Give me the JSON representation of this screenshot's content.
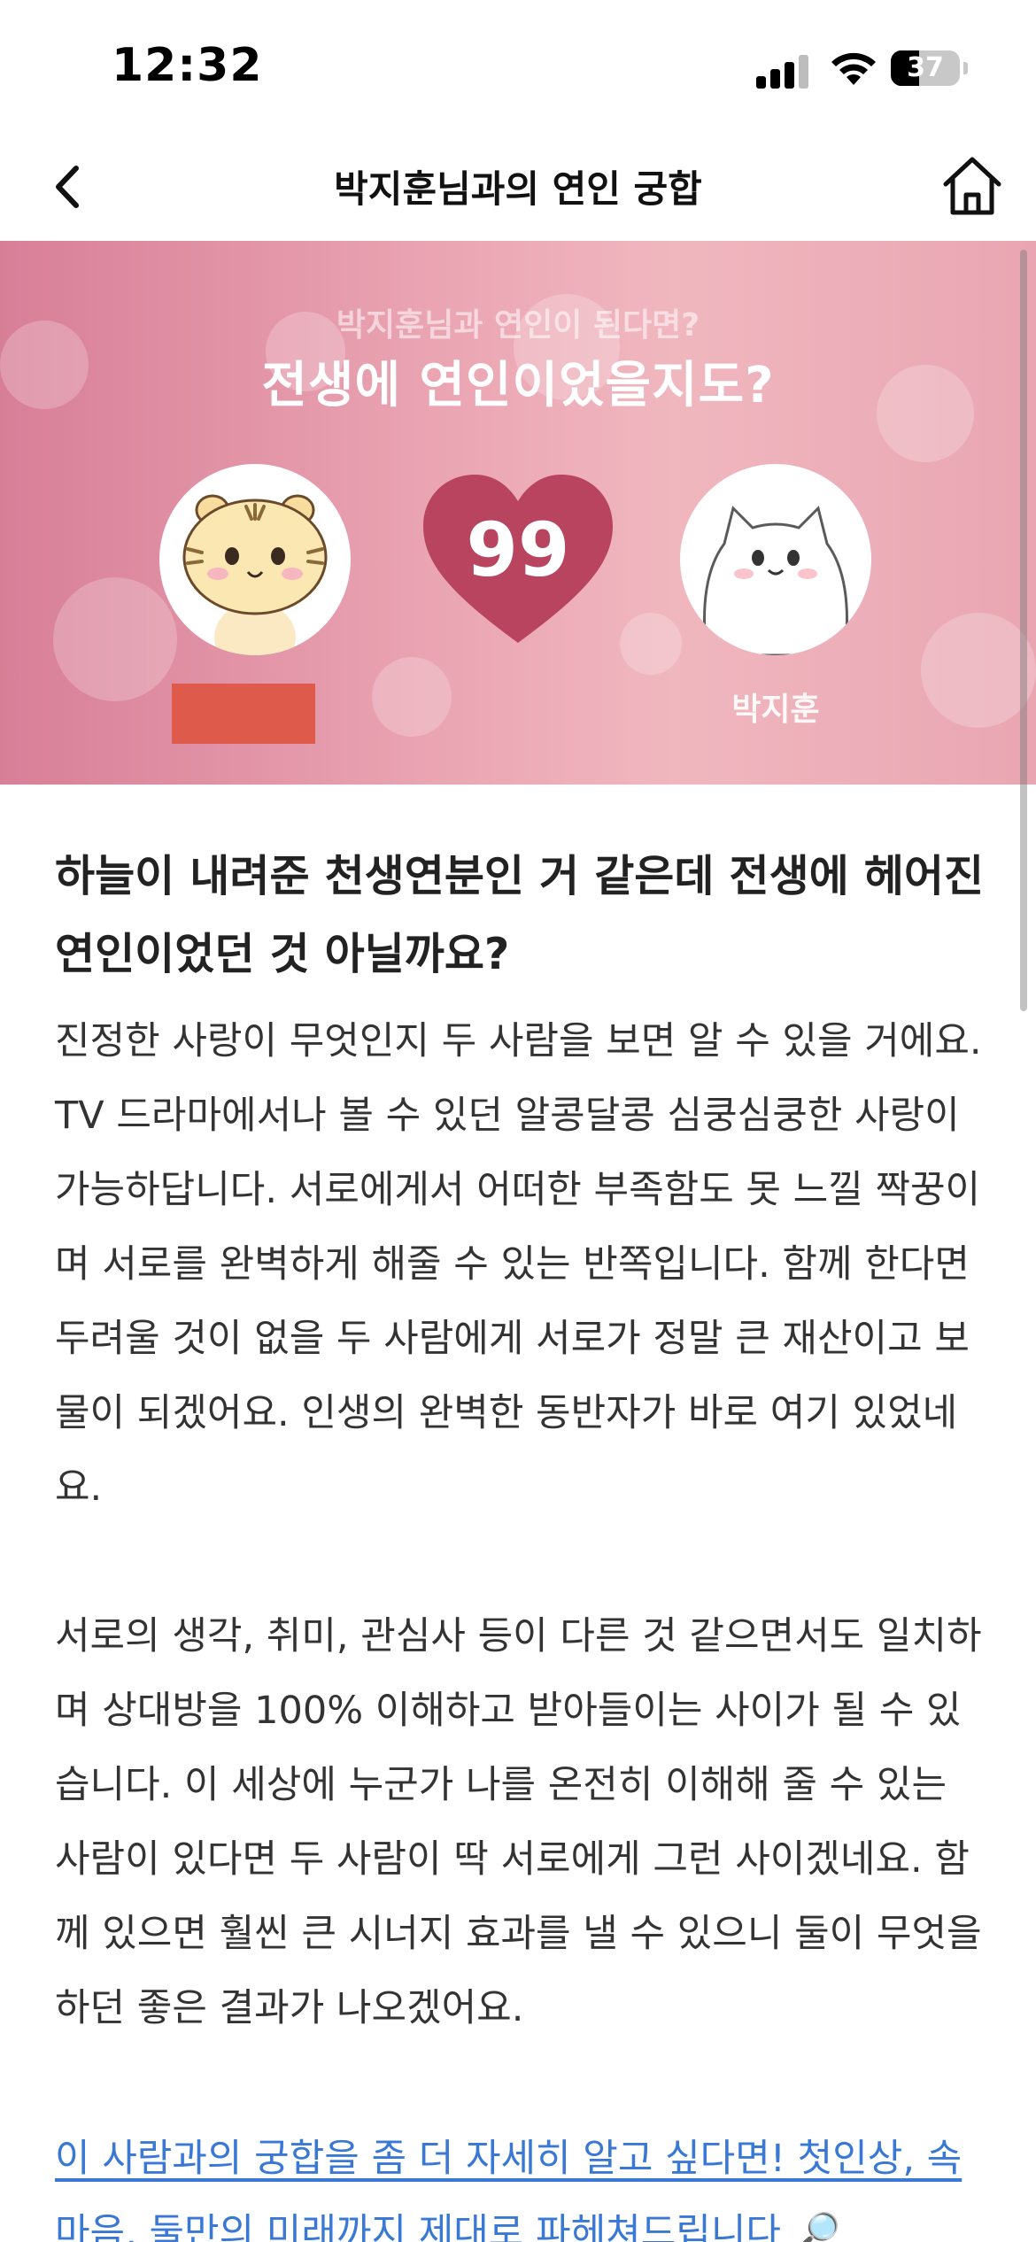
{
  "status": {
    "time": "12:32",
    "battery": "37"
  },
  "nav": {
    "title": "박지훈님과의 연인 궁합",
    "back_icon": "chevron-left-icon",
    "home_icon": "home-icon"
  },
  "banner": {
    "subtitle": "박지훈님과 연인이 된다면?",
    "title": "전생에 연인이었을지도?",
    "score": "99",
    "right_name": "박지훈",
    "left_avatar": "tiger-character",
    "right_avatar": "white-cat-character",
    "accent_color": "#b8445f"
  },
  "content": {
    "headline": "하늘이 내려준 천생연분인 거 같은데 전생에 헤어진 연인이었던 것 아닐까요?",
    "paragraph1": "진정한 사랑이 무엇인지 두 사람을 보면 알 수 있을 거에요. TV 드라마에서나 볼 수 있던 알콩달콩 심쿵심쿵한 사랑이 가능하답니다. 서로에게서 어떠한 부족함도 못 느낄 짝꿍이며 서로를 완벽하게 해줄 수 있는 반쪽입니다. 함께 한다면 두려울 것이 없을 두 사람에게 서로가 정말 큰 재산이고 보물이 되겠어요. 인생의 완벽한 동반자가 바로 여기 있었네요.",
    "paragraph2": "서로의 생각, 취미, 관심사 등이 다른 것 같으면서도 일치하며 상대방을 100% 이해하고 받아들이는 사이가 될 수 있습니다. 이 세상에 누군가 나를 온전히 이해해 줄 수 있는 사람이 있다면 두 사람이 딱 서로에게 그런 사이겠네요. 함께 있으면 훨씬 큰 시너지 효과를 낼 수 있으니 둘이 무엇을 하던 좋은 결과가 나오겠어요.",
    "link": "이 사람과의 궁합을 좀 더 자세히 알고 싶다면! 첫인상, 속마음, 둘만의 미래까지 제대로 파헤쳐드립니다 🔎"
  }
}
